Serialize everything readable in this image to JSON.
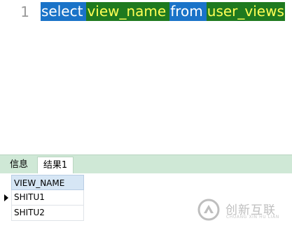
{
  "editor": {
    "line_number": "1",
    "tokens": {
      "select": "select",
      "column": "view_name",
      "from": "from",
      "table": "user_views"
    }
  },
  "tabs": {
    "info": "信息",
    "result": "结果1"
  },
  "result_grid": {
    "column_header": "VIEW_NAME",
    "rows": [
      "SHITU1",
      "SHITU2"
    ]
  },
  "watermark": {
    "text": "创新互联",
    "subtext": "CHUANG XIN HU LIAN"
  },
  "colors": {
    "keyword_highlight": "#1a73c8",
    "identifier_highlight": "#1f7a1f",
    "identifier_text": "#ffff55",
    "tab_bar": "#cfe8d6",
    "grid_header": "#d6e6f5"
  }
}
